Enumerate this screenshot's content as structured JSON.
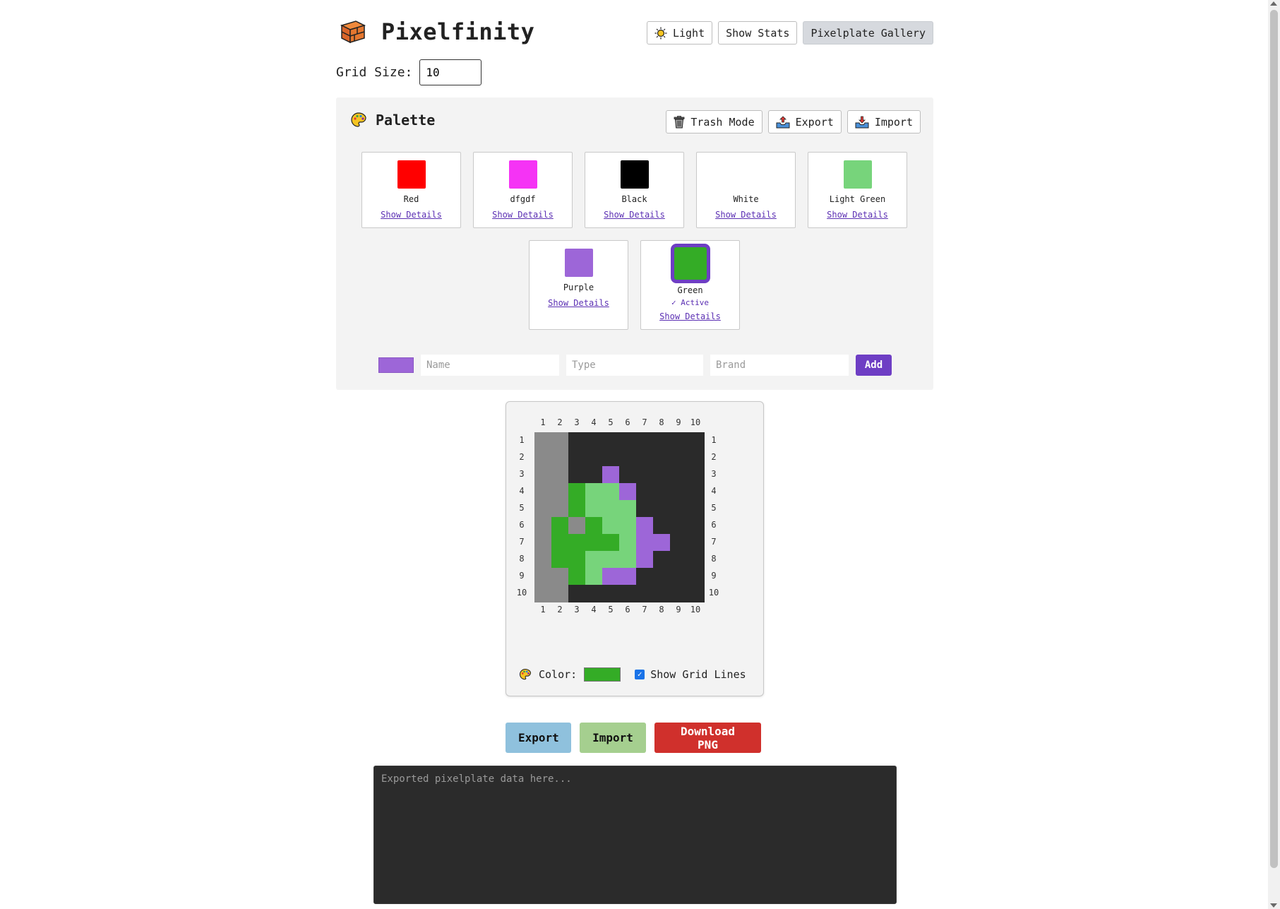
{
  "app": {
    "title": "Pixelfinity"
  },
  "header": {
    "theme_label": "Light",
    "stats_label": "Show Stats",
    "gallery_label": "Pixelplate Gallery"
  },
  "grid_size": {
    "label": "Grid Size:",
    "value": "10"
  },
  "palette": {
    "title": "Palette",
    "trash_label": "Trash Mode",
    "export_label": "Export",
    "import_label": "Import",
    "details_label": "Show Details",
    "active_label": "✓ Active",
    "colors": [
      {
        "name": "Red",
        "hex": "#ff0000"
      },
      {
        "name": "dfgdf",
        "hex": "#f533f5"
      },
      {
        "name": "Black",
        "hex": "#000000"
      },
      {
        "name": "White",
        "hex": "#ffffff"
      },
      {
        "name": "Light Green",
        "hex": "#77d47b"
      },
      {
        "name": "Purple",
        "hex": "#9d66d8"
      },
      {
        "name": "Green",
        "hex": "#34ac26",
        "active": true
      }
    ],
    "add_form": {
      "color": "#9d66d8",
      "name_placeholder": "Name",
      "type_placeholder": "Type",
      "brand_placeholder": "Brand",
      "add_label": "Add"
    }
  },
  "canvas": {
    "column_labels": [
      "1",
      "2",
      "3",
      "4",
      "5",
      "6",
      "7",
      "8",
      "9",
      "10"
    ],
    "row_labels": [
      "1",
      "2",
      "3",
      "4",
      "5",
      "6",
      "7",
      "8",
      "9",
      "10"
    ],
    "cell_colors": {
      "K": "#2a2a2a",
      "G": "#8a8a8a",
      "D": "#34ac26",
      "L": "#77d47b",
      "P": "#9d66d8"
    },
    "rows": [
      "GGKKKKKKKK",
      "GGKKKKKKKK",
      "GGKKPKKKKK",
      "GGDLLPKKKK",
      "GGDLLLKKKK",
      "GDGDLLPKKK",
      "GDDDDLPPKK",
      "GDDLLLPKKK",
      "GGDLPPKKKK",
      "GGKKKKKKKK"
    ],
    "color_label": "Color:",
    "current_color": "#34ac26",
    "show_grid_label": "Show Grid Lines",
    "show_grid_checked": true
  },
  "actions": {
    "export_label": "Export",
    "import_label": "Import",
    "download_label": "Download PNG"
  },
  "export_area": {
    "placeholder": "Exported pixelplate data here..."
  }
}
